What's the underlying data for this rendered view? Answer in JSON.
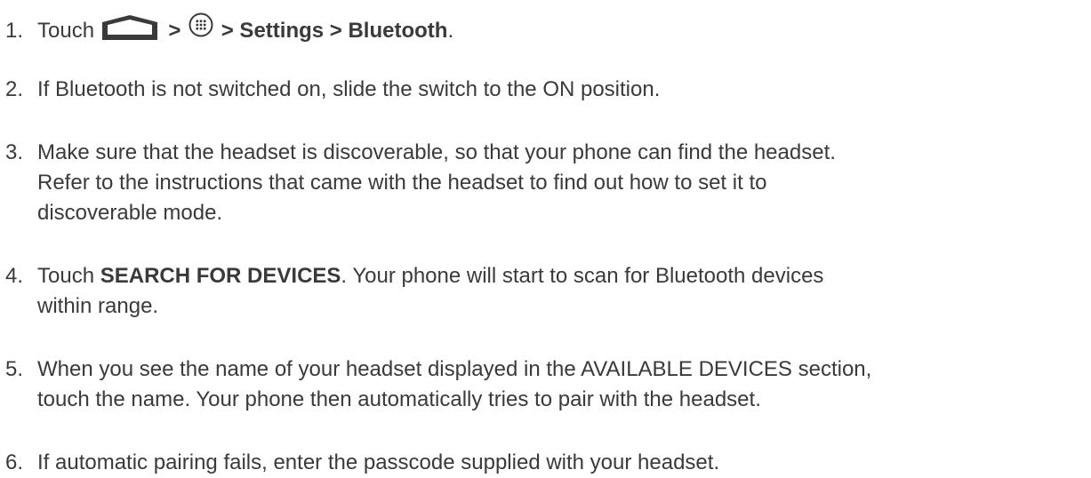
{
  "steps": [
    {
      "number": "1.",
      "prefix": "Touch",
      "separator1": ">",
      "separator2": "> Settings > Bluetooth",
      "suffix": ".",
      "icons": [
        "home-icon",
        "apps-icon"
      ]
    },
    {
      "number": "2.",
      "text": "If Bluetooth is not switched on, slide the switch to the ON position."
    },
    {
      "number": "3.",
      "line1": "Make sure that the headset is discoverable, so that your phone can find the headset.",
      "line2": "Refer to the instructions that came with the headset to find out how to set it to",
      "line3": "discoverable mode."
    },
    {
      "number": "4.",
      "prefix": "Touch",
      "bold": "SEARCH FOR DEVICES",
      "rest_line1": ". Your phone will start to scan for Bluetooth devices",
      "line2": "within range."
    },
    {
      "number": "5.",
      "line1": "When you see the name of your headset displayed in the AVAILABLE DEVICES section,",
      "line2": "touch the name. Your phone then automatically tries to pair with the headset."
    },
    {
      "number": "6.",
      "text": "If automatic pairing fails, enter the passcode supplied with your headset."
    }
  ]
}
